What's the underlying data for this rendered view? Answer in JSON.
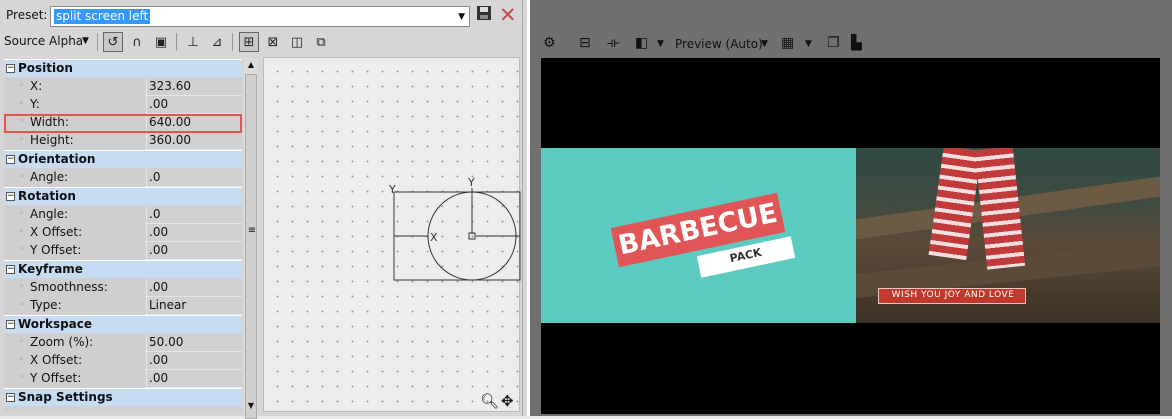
{
  "preset": {
    "label": "Preset:",
    "value": "split screen left"
  },
  "toolbar": {
    "source_mode": "Source Alpha"
  },
  "properties": {
    "categories": [
      {
        "name": "Position",
        "rows": [
          {
            "key": "X:",
            "value": "323.60"
          },
          {
            "key": "Y:",
            "value": ".00"
          },
          {
            "key": "Width:",
            "value": "640.00"
          },
          {
            "key": "Height:",
            "value": "360.00"
          }
        ]
      },
      {
        "name": "Orientation",
        "rows": [
          {
            "key": "Angle:",
            "value": ".0"
          }
        ]
      },
      {
        "name": "Rotation",
        "rows": [
          {
            "key": "Angle:",
            "value": ".0"
          },
          {
            "key": "X Offset:",
            "value": ".00"
          },
          {
            "key": "Y Offset:",
            "value": ".00"
          }
        ]
      },
      {
        "name": "Keyframe",
        "rows": [
          {
            "key": "Smoothness:",
            "value": ".00"
          },
          {
            "key": "Type:",
            "value": "Linear"
          }
        ]
      },
      {
        "name": "Workspace",
        "rows": [
          {
            "key": "Zoom (%):",
            "value": "50.00"
          },
          {
            "key": "X Offset:",
            "value": ".00"
          },
          {
            "key": "Y Offset:",
            "value": ".00"
          }
        ]
      },
      {
        "name": "Snap Settings",
        "rows": []
      }
    ]
  },
  "canvas": {
    "axis_y_left": "Y",
    "axis_y_top": "Y",
    "axis_x": "X"
  },
  "preview": {
    "mode": "Preview (Auto)"
  },
  "video": {
    "title": "BARBECUE",
    "subtitle": "PACK",
    "banner": "WISH YOU JOY AND LOVE"
  },
  "colors": {
    "accent": "#3399ff",
    "category": "#c5dcf2",
    "highlight": "#e0554d",
    "teal": "#5dcabf"
  }
}
